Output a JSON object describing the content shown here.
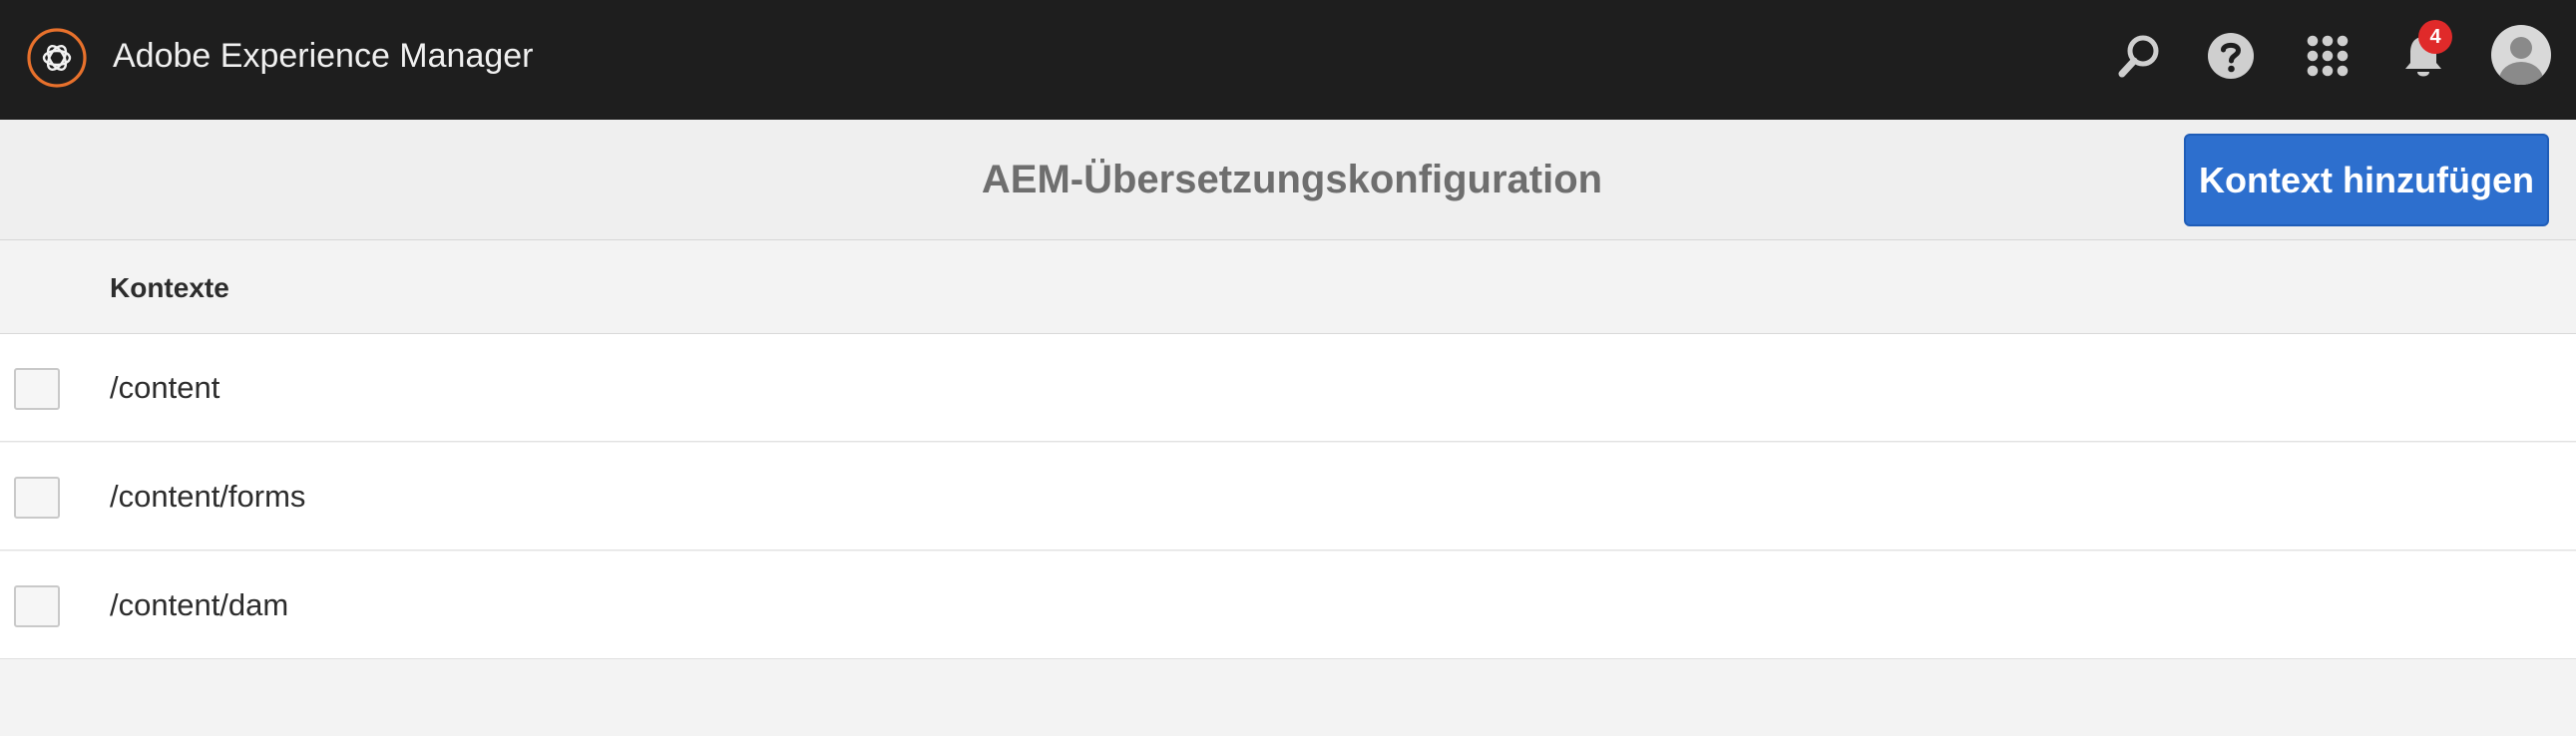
{
  "shell": {
    "app_title": "Adobe Experience Manager",
    "notification_count": "4",
    "icons": [
      "search-icon",
      "help-icon",
      "solutions-grid-icon",
      "bell-icon",
      "user-avatar"
    ]
  },
  "action_bar": {
    "title": "AEM-Übersetzungskonfiguration",
    "add_context_label": "Kontext hinzufügen"
  },
  "table": {
    "column_header": "Kontexte",
    "rows": [
      {
        "path": "/content"
      },
      {
        "path": "/content/forms"
      },
      {
        "path": "/content/dam"
      }
    ]
  },
  "colors": {
    "shell_bg": "#1e1e1e",
    "accent_orange": "#e8712c",
    "primary_blue": "#2d6fce",
    "badge_red": "#e02a2a"
  }
}
